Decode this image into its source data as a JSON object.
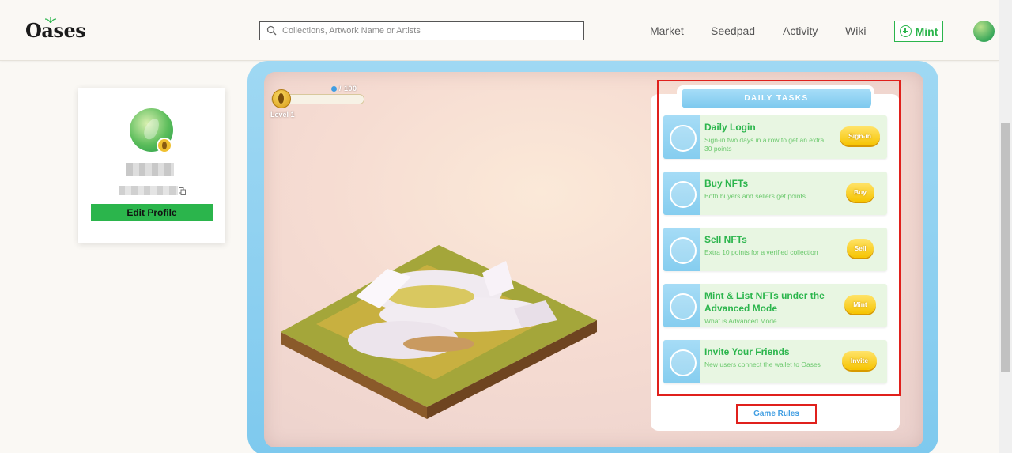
{
  "header": {
    "logo": "Oases",
    "search_placeholder": "Collections, Artwork Name or Artists",
    "nav": [
      "Market",
      "Seedpad",
      "Activity",
      "Wiki"
    ],
    "mint_label": "Mint"
  },
  "profile": {
    "edit_label": "Edit Profile"
  },
  "game": {
    "points": "/ 100",
    "level": "Level 1",
    "progress_fraction": 0,
    "tasks_title": "DAILY TASKS",
    "tasks": [
      {
        "title": "Daily Login",
        "desc": "Sign-in two days in a row to get an extra 30 points",
        "button": "Sign-in"
      },
      {
        "title": "Buy NFTs",
        "desc": "Both buyers and sellers get points",
        "button": "Buy"
      },
      {
        "title": "Sell NFTs",
        "desc": "Extra 10 points for a verified collection",
        "button": "Sell"
      },
      {
        "title": "Mint & List NFTs under the Advanced Mode",
        "desc": "What is Advanced Mode",
        "button": "Mint"
      },
      {
        "title": "Invite Your Friends",
        "desc": "New users connect the wallet to Oases",
        "button": "Invite"
      }
    ],
    "rules_label": "Game Rules"
  },
  "colors": {
    "accent_green": "#2bb54c",
    "accent_blue": "#3f9de2",
    "button_yellow": "#f6c400",
    "highlight_red": "#e0201c"
  }
}
